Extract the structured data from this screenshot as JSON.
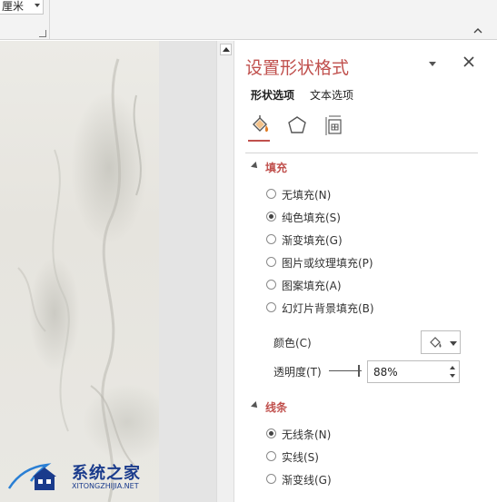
{
  "ribbon": {
    "unit_value": "厘米"
  },
  "panel": {
    "title": "设置形状格式",
    "tabs": [
      {
        "label": "形状选项",
        "active": true
      },
      {
        "label": "文本选项",
        "active": false
      }
    ],
    "category_icons": [
      "fill-line-icon",
      "effects-icon",
      "size-properties-icon"
    ],
    "fill_section": {
      "title": "填充",
      "options": [
        {
          "label": "无填充(N)",
          "selected": false
        },
        {
          "label": "纯色填充(S)",
          "selected": true
        },
        {
          "label": "渐变填充(G)",
          "selected": false
        },
        {
          "label": "图片或纹理填充(P)",
          "selected": false
        },
        {
          "label": "图案填充(A)",
          "selected": false
        },
        {
          "label": "幻灯片背景填充(B)",
          "selected": false
        }
      ],
      "color_label": "颜色(C)",
      "transparency_label": "透明度(T)",
      "transparency_value": "88%",
      "transparency_fraction": 0.88
    },
    "line_section": {
      "title": "线条",
      "options": [
        {
          "label": "无线条(N)",
          "selected": true
        },
        {
          "label": "实线(S)",
          "selected": false
        },
        {
          "label": "渐变线(G)",
          "selected": false
        }
      ]
    }
  },
  "watermark": {
    "title": "系统之家",
    "subtitle": "XITONGZHIJIA.NET"
  },
  "colors": {
    "accent": "#c0504d",
    "watermark_blue": "#1a3b8c"
  }
}
